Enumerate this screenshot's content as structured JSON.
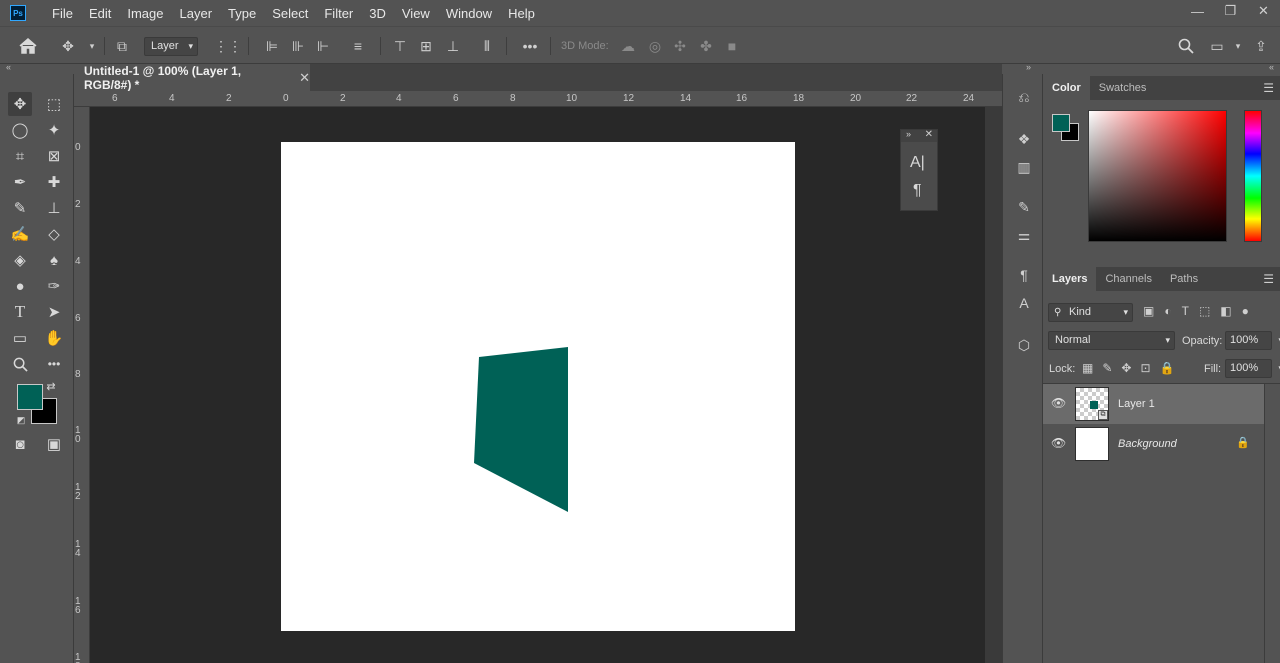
{
  "app": {
    "logo_text": "Ps"
  },
  "menu": [
    "File",
    "Edit",
    "Image",
    "Layer",
    "Type",
    "Select",
    "Filter",
    "3D",
    "View",
    "Window",
    "Help"
  ],
  "window_controls": {
    "minimize": "—",
    "restore": "❐",
    "close": "✕"
  },
  "options_bar": {
    "auto_select_value": "Layer",
    "mode_3d_label": "3D Mode:",
    "more_label": "•••"
  },
  "document": {
    "tab_title": "Untitled-1 @ 100% (Layer 1, RGB/8#) *",
    "close_glyph": "✕",
    "ruler_h_labels": [
      "6",
      "4",
      "2",
      "0",
      "2",
      "4",
      "6",
      "8",
      "10",
      "12",
      "14",
      "16",
      "18",
      "20",
      "22",
      "24"
    ],
    "ruler_v_labels": [
      "0",
      "2",
      "4",
      "6",
      "8",
      "1\n0",
      "1\n2",
      "1\n4",
      "1\n6",
      "1\n8"
    ],
    "shape_color": "#006156"
  },
  "colors": {
    "foreground": "#006156",
    "background": "#000000"
  },
  "color_panel": {
    "tabs": [
      "Color",
      "Swatches"
    ]
  },
  "layers_panel": {
    "tabs": [
      "Layers",
      "Channels",
      "Paths"
    ],
    "filter_kind": "Kind",
    "blend_mode": "Normal",
    "opacity_label": "Opacity:",
    "opacity_value": "100%",
    "lock_label": "Lock:",
    "fill_label": "Fill:",
    "fill_value": "100%",
    "layers": [
      {
        "name": "Layer 1",
        "selected": true
      },
      {
        "name": "Background",
        "selected": false,
        "locked": true
      }
    ]
  },
  "float_panel": {
    "char_glyph": "A|",
    "para_glyph": "¶"
  }
}
